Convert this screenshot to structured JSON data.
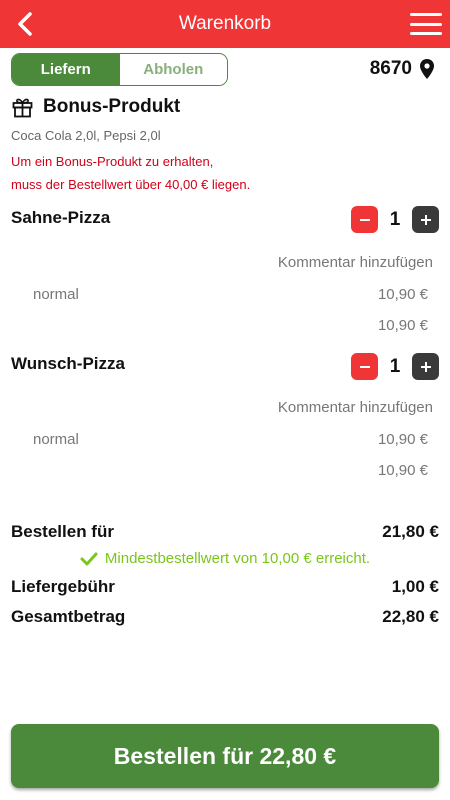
{
  "header": {
    "title": "Warenkorb"
  },
  "mode": {
    "delivery_label": "Liefern",
    "pickup_label": "Abholen"
  },
  "location": {
    "zip": "8670"
  },
  "bonus": {
    "title": "Bonus-Produkt",
    "items": "Coca Cola 2,0l, Pepsi 2,0l",
    "note_line1": "Um ein Bonus-Produkt zu erhalten,",
    "note_line2": "muss der Bestellwert über 40,00 € liegen."
  },
  "cart_items": [
    {
      "name": "Sahne-Pizza",
      "qty": "1",
      "comment_label": "Kommentar hinzufügen",
      "variant": "normal",
      "variant_price": "10,90 €",
      "total": "10,90 €"
    },
    {
      "name": "Wunsch-Pizza",
      "qty": "1",
      "comment_label": "Kommentar hinzufügen",
      "variant": "normal",
      "variant_price": "10,90 €",
      "total": "10,90 €"
    }
  ],
  "summary": {
    "subtotal_label": "Bestellen für",
    "subtotal_value": "21,80 €",
    "min_order_msg": "Mindestbestellwert von 10,00 € erreicht.",
    "delivery_fee_label": "Liefergebühr",
    "delivery_fee_value": "1,00 €",
    "total_label": "Gesamtbetrag",
    "total_value": "22,80 €"
  },
  "order_button": {
    "label": "Bestellen für 22,80 €"
  },
  "colors": {
    "header_red": "#ef3535",
    "primary_green": "#4b8a3a",
    "success_green": "#7ac61a",
    "warning_red": "#d0021b"
  }
}
